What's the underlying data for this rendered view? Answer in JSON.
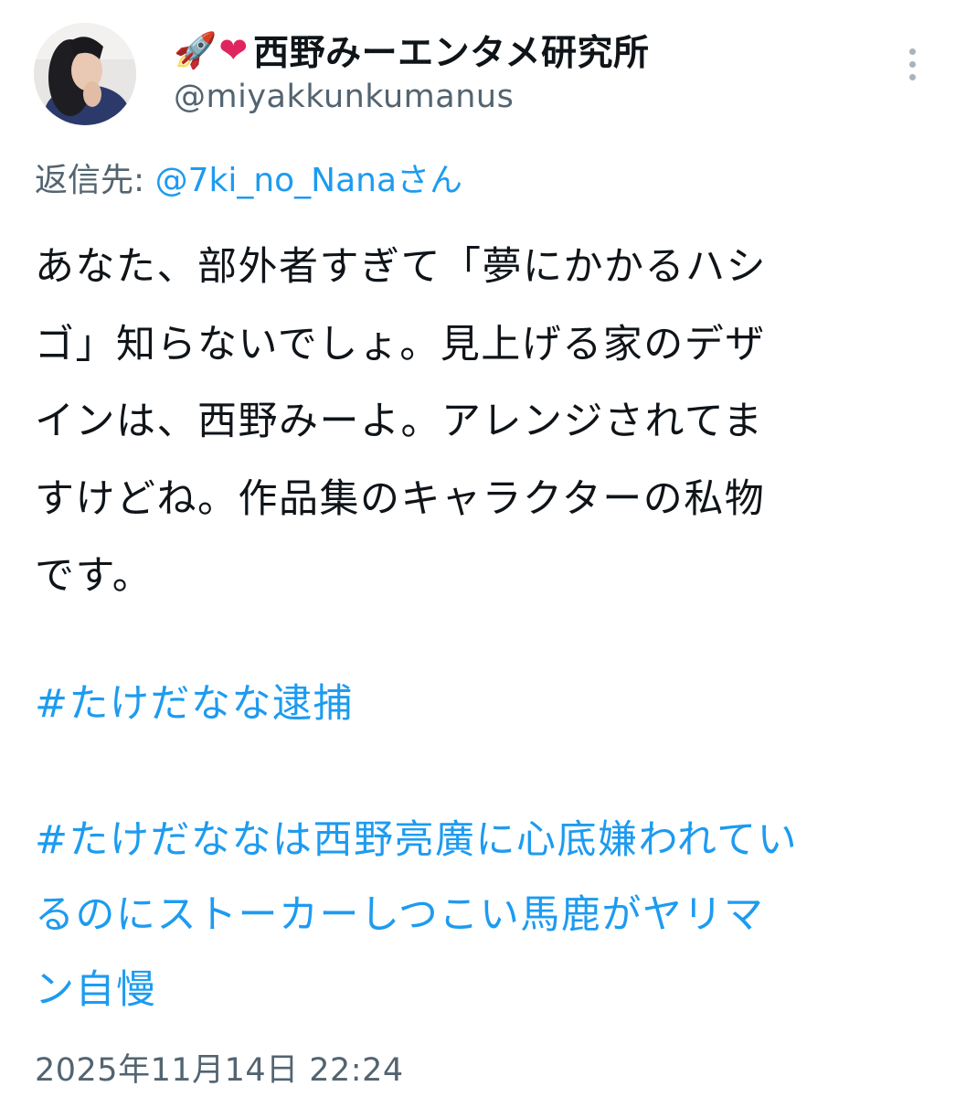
{
  "author": {
    "name_emojis": [
      "🚀",
      "❤"
    ],
    "display_name": "西野みーエンタメ研究所",
    "handle": "@miyakkunkumanus"
  },
  "icons": {
    "avatar": "avatar",
    "more": "more-vertical-icon",
    "heart_color": "#e0245e"
  },
  "reply_to": {
    "label": "返信先: ",
    "mention": "@7ki_no_Nanaさん"
  },
  "body_lines": [
    "あなた、部外者すぎて「夢にかかるハシ",
    "ゴ」知らないでしょ。見上げる家のデザ",
    "インは、西野みーよ。アレンジされてま",
    "すけどね。作品集のキャラクターの私物",
    "です。"
  ],
  "hashtags": [
    {
      "lines": [
        "#たけだなな逮捕"
      ]
    },
    {
      "lines": [
        "#たけだななは西野亮廣に心底嫌われてい",
        "るのにストーカーしつこい馬鹿がヤリマ",
        "ン自慢"
      ]
    }
  ],
  "timestamp": "2025年11月14日 22:24",
  "colors": {
    "text": "#0f1419",
    "secondary": "#536471",
    "link": "#1d9bf0"
  }
}
